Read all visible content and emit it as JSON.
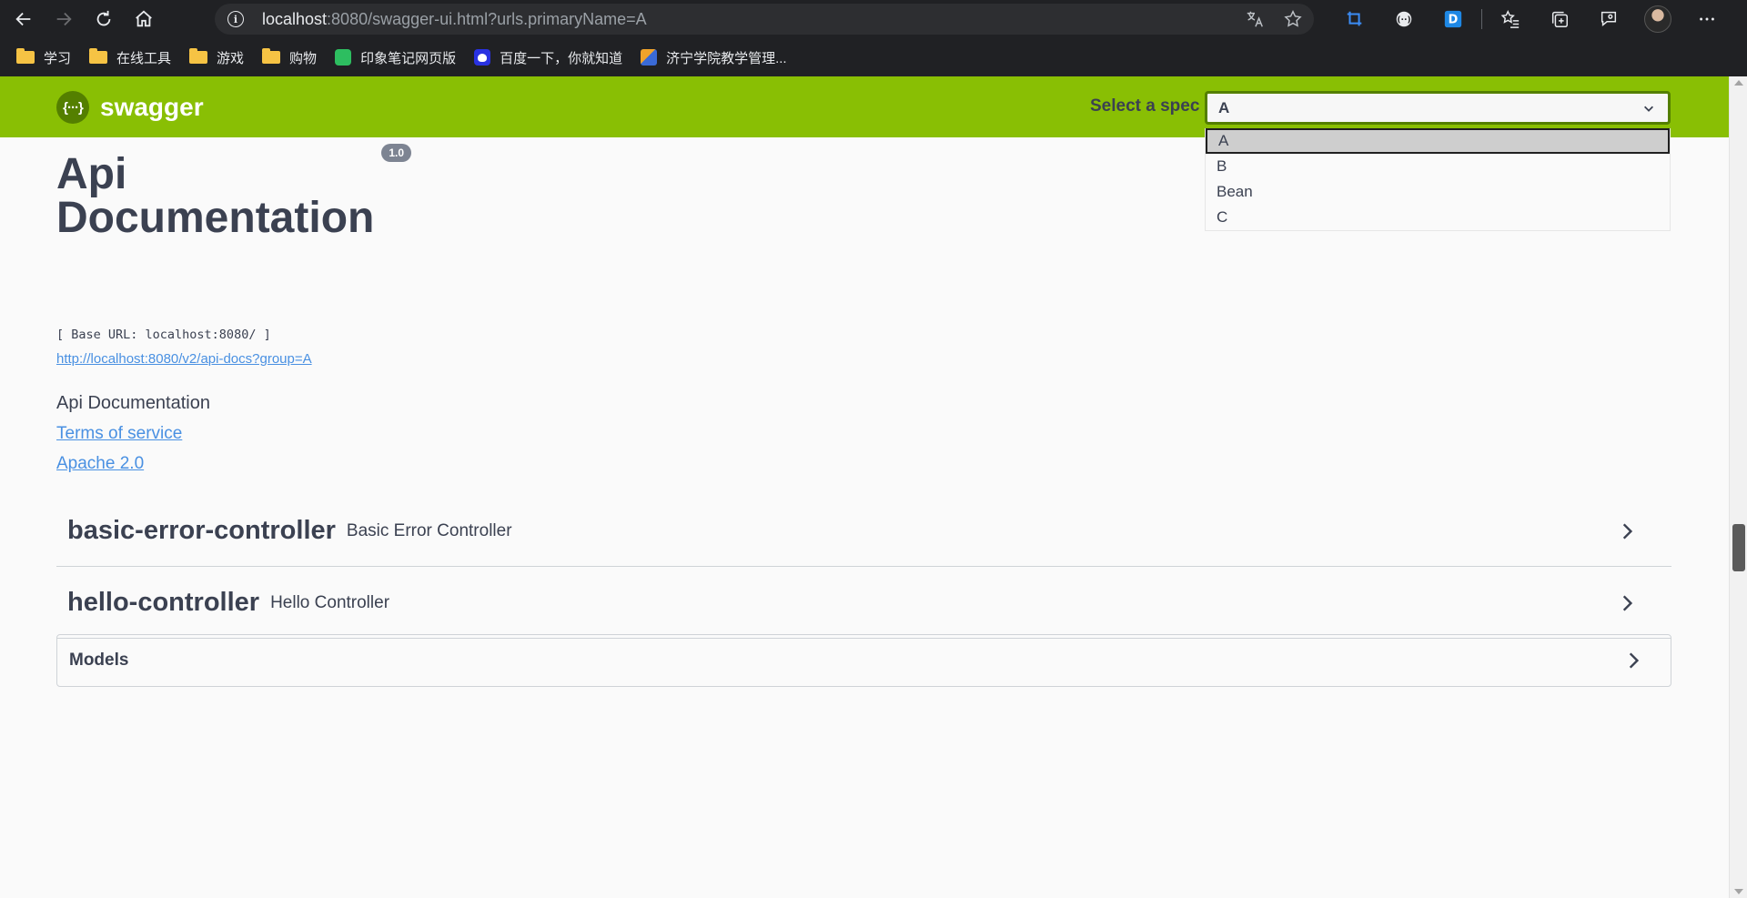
{
  "browser": {
    "url_host": "localhost",
    "url_rest": ":8080/swagger-ui.html?urls.primaryName=A"
  },
  "bookmarks": [
    {
      "label": "学习",
      "icon": "folder-icon"
    },
    {
      "label": "在线工具",
      "icon": "folder-icon"
    },
    {
      "label": "游戏",
      "icon": "folder-icon"
    },
    {
      "label": "购物",
      "icon": "folder-icon"
    },
    {
      "label": "印象笔记网页版",
      "icon": "evernote-icon"
    },
    {
      "label": "百度一下，你就知道",
      "icon": "baidu-icon"
    },
    {
      "label": "济宁学院教学管理...",
      "icon": "school-icon"
    }
  ],
  "topbar": {
    "logo_text": "swagger",
    "logo_mark": "{···}",
    "spec_label": "Select a spec",
    "spec_selected": "A",
    "spec_options": [
      "A",
      "B",
      "Bean",
      "C"
    ]
  },
  "info": {
    "title": "Api Documentation",
    "version": "1.0",
    "base_url": "[ Base URL: localhost:8080/ ]",
    "api_docs_link": "http://localhost:8080/v2/api-docs?group=A",
    "description": "Api Documentation",
    "terms": "Terms of service",
    "license": "Apache 2.0"
  },
  "tags": [
    {
      "name": "basic-error-controller",
      "description": "Basic Error Controller"
    },
    {
      "name": "hello-controller",
      "description": "Hello Controller"
    }
  ],
  "models": {
    "label": "Models"
  },
  "colors": {
    "topbar": "#89bf04",
    "text": "#3b4151",
    "link": "#4990e2"
  }
}
